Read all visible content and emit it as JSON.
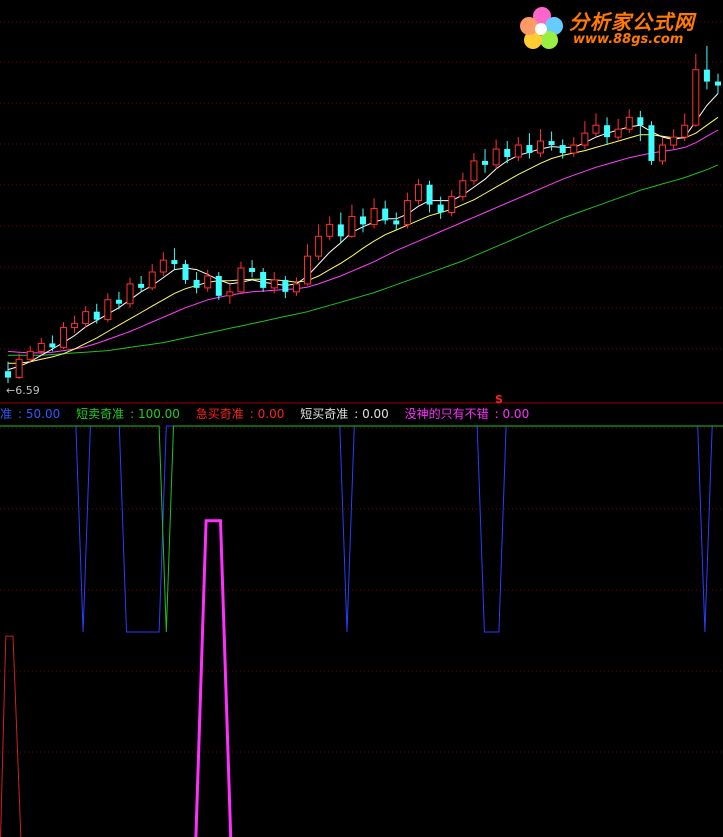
{
  "logo": {
    "name": "分析家公式网",
    "url": "www.88gs.com"
  },
  "price_low_label": "←6.59",
  "signal_marker": "S",
  "legend": [
    {
      "label": "准",
      "value": "50.00",
      "color": "#2a5cff"
    },
    {
      "label": "短卖奇准",
      "value": "100.00",
      "color": "#20d020"
    },
    {
      "label": "急买奇准",
      "value": "0.00",
      "color": "#ff2020"
    },
    {
      "label": "短买奇准",
      "value": "0.00",
      "color": "#e0e0e0"
    },
    {
      "label": "没神的只有不错",
      "value": "0.00",
      "color": "#ff30ff"
    }
  ],
  "colors": {
    "up": "#ff3030",
    "down": "#40ffff",
    "ma_short": "#ffffff",
    "ma_mid": "#ffff60",
    "ma_long": "#ff40ff",
    "ma_slow": "#20c020",
    "grid": "#7a0000"
  },
  "chart_data": [
    {
      "type": "candlestick",
      "title": "",
      "ylim": [
        6.4,
        11.0
      ],
      "candles": [
        [
          6.7,
          6.62,
          6.82,
          6.55
        ],
        [
          6.62,
          6.85,
          6.92,
          6.6
        ],
        [
          6.85,
          6.95,
          7.02,
          6.8
        ],
        [
          6.95,
          7.05,
          7.12,
          6.9
        ],
        [
          7.05,
          7.0,
          7.15,
          6.95
        ],
        [
          7.0,
          7.25,
          7.32,
          6.98
        ],
        [
          7.25,
          7.3,
          7.4,
          7.18
        ],
        [
          7.3,
          7.45,
          7.52,
          7.25
        ],
        [
          7.45,
          7.35,
          7.55,
          7.3
        ],
        [
          7.35,
          7.6,
          7.68,
          7.32
        ],
        [
          7.6,
          7.55,
          7.7,
          7.48
        ],
        [
          7.55,
          7.8,
          7.88,
          7.5
        ],
        [
          7.8,
          7.75,
          7.9,
          7.7
        ],
        [
          7.75,
          7.95,
          8.05,
          7.72
        ],
        [
          7.95,
          8.1,
          8.2,
          7.9
        ],
        [
          8.1,
          8.05,
          8.25,
          7.98
        ],
        [
          8.05,
          7.85,
          8.1,
          7.8
        ],
        [
          7.85,
          7.75,
          7.95,
          7.68
        ],
        [
          7.75,
          7.9,
          7.98,
          7.7
        ],
        [
          7.9,
          7.65,
          7.95,
          7.6
        ],
        [
          7.65,
          7.7,
          7.8,
          7.55
        ],
        [
          7.7,
          8.0,
          8.08,
          7.68
        ],
        [
          8.0,
          7.95,
          8.1,
          7.88
        ],
        [
          7.95,
          7.75,
          8.0,
          7.7
        ],
        [
          7.75,
          7.85,
          7.95,
          7.68
        ],
        [
          7.85,
          7.7,
          7.9,
          7.62
        ],
        [
          7.7,
          7.8,
          7.88,
          7.65
        ],
        [
          7.8,
          8.15,
          8.3,
          7.78
        ],
        [
          8.15,
          8.4,
          8.55,
          8.1
        ],
        [
          8.4,
          8.55,
          8.65,
          8.35
        ],
        [
          8.55,
          8.4,
          8.7,
          8.32
        ],
        [
          8.4,
          8.65,
          8.8,
          8.38
        ],
        [
          8.65,
          8.55,
          8.75,
          8.45
        ],
        [
          8.55,
          8.75,
          8.88,
          8.5
        ],
        [
          8.75,
          8.6,
          8.85,
          8.55
        ],
        [
          8.6,
          8.55,
          8.7,
          8.48
        ],
        [
          8.55,
          8.85,
          8.95,
          8.5
        ],
        [
          8.85,
          9.05,
          9.12,
          8.8
        ],
        [
          9.05,
          8.8,
          9.1,
          8.7
        ],
        [
          8.8,
          8.7,
          8.9,
          8.62
        ],
        [
          8.7,
          8.9,
          8.98,
          8.65
        ],
        [
          8.9,
          9.1,
          9.2,
          8.85
        ],
        [
          9.1,
          9.35,
          9.45,
          9.05
        ],
        [
          9.35,
          9.3,
          9.5,
          9.2
        ],
        [
          9.3,
          9.5,
          9.62,
          9.25
        ],
        [
          9.5,
          9.4,
          9.6,
          9.32
        ],
        [
          9.4,
          9.55,
          9.65,
          9.35
        ],
        [
          9.55,
          9.45,
          9.7,
          9.38
        ],
        [
          9.45,
          9.6,
          9.75,
          9.4
        ],
        [
          9.6,
          9.55,
          9.72,
          9.48
        ],
        [
          9.55,
          9.45,
          9.62,
          9.38
        ],
        [
          9.45,
          9.55,
          9.65,
          9.4
        ],
        [
          9.55,
          9.7,
          9.85,
          9.5
        ],
        [
          9.7,
          9.8,
          9.95,
          9.65
        ],
        [
          9.8,
          9.65,
          9.9,
          9.55
        ],
        [
          9.65,
          9.75,
          9.88,
          9.6
        ],
        [
          9.75,
          9.9,
          10.0,
          9.7
        ],
        [
          9.9,
          9.8,
          9.98,
          9.6
        ],
        [
          9.8,
          9.35,
          9.85,
          9.3
        ],
        [
          9.35,
          9.55,
          9.65,
          9.3
        ],
        [
          9.55,
          9.65,
          9.75,
          9.5
        ],
        [
          9.65,
          9.8,
          9.95,
          9.6
        ],
        [
          9.8,
          10.5,
          10.7,
          9.78
        ],
        [
          10.5,
          10.35,
          10.8,
          10.25
        ],
        [
          10.35,
          10.3,
          10.45,
          10.2
        ]
      ],
      "ma": {
        "ma_short": [
          6.72,
          6.76,
          6.82,
          6.9,
          6.98,
          7.06,
          7.15,
          7.26,
          7.34,
          7.42,
          7.5,
          7.6,
          7.7,
          7.78,
          7.88,
          7.98,
          8.0,
          7.98,
          7.92,
          7.85,
          7.8,
          7.82,
          7.85,
          7.82,
          7.8,
          7.78,
          7.8,
          7.9,
          8.05,
          8.2,
          8.32,
          8.45,
          8.52,
          8.58,
          8.62,
          8.62,
          8.68,
          8.78,
          8.85,
          8.85,
          8.85,
          8.92,
          9.02,
          9.12,
          9.25,
          9.35,
          9.42,
          9.46,
          9.5,
          9.53,
          9.52,
          9.52,
          9.58,
          9.65,
          9.7,
          9.74,
          9.78,
          9.8,
          9.72,
          9.65,
          9.62,
          9.65,
          9.85,
          10.05,
          10.2
        ],
        "ma_mid": [
          6.8,
          6.8,
          6.82,
          6.85,
          6.88,
          6.92,
          6.98,
          7.05,
          7.12,
          7.2,
          7.28,
          7.36,
          7.44,
          7.52,
          7.6,
          7.68,
          7.74,
          7.78,
          7.82,
          7.84,
          7.84,
          7.85,
          7.86,
          7.86,
          7.85,
          7.84,
          7.82,
          7.84,
          7.9,
          7.98,
          8.06,
          8.15,
          8.25,
          8.34,
          8.42,
          8.48,
          8.54,
          8.6,
          8.66,
          8.7,
          8.74,
          8.8,
          8.86,
          8.94,
          9.02,
          9.1,
          9.18,
          9.25,
          9.32,
          9.38,
          9.42,
          9.45,
          9.48,
          9.52,
          9.56,
          9.6,
          9.64,
          9.68,
          9.68,
          9.66,
          9.64,
          9.64,
          9.7,
          9.8,
          9.9
        ],
        "ma_long": [
          6.95,
          6.94,
          6.93,
          6.93,
          6.94,
          6.96,
          6.98,
          7.01,
          7.05,
          7.1,
          7.15,
          7.2,
          7.26,
          7.32,
          7.38,
          7.44,
          7.5,
          7.55,
          7.6,
          7.63,
          7.66,
          7.68,
          7.7,
          7.71,
          7.72,
          7.73,
          7.74,
          7.76,
          7.8,
          7.85,
          7.9,
          7.96,
          8.02,
          8.08,
          8.15,
          8.22,
          8.28,
          8.34,
          8.4,
          8.46,
          8.52,
          8.58,
          8.64,
          8.7,
          8.76,
          8.82,
          8.88,
          8.94,
          9.0,
          9.06,
          9.12,
          9.17,
          9.22,
          9.27,
          9.31,
          9.35,
          9.39,
          9.42,
          9.45,
          9.47,
          9.49,
          9.52,
          9.58,
          9.66,
          9.74
        ],
        "ma_slow": [
          6.9,
          6.9,
          6.9,
          6.9,
          6.91,
          6.92,
          6.93,
          6.94,
          6.95,
          6.96,
          6.98,
          7.0,
          7.02,
          7.04,
          7.06,
          7.09,
          7.12,
          7.15,
          7.18,
          7.21,
          7.24,
          7.27,
          7.3,
          7.33,
          7.36,
          7.39,
          7.42,
          7.45,
          7.49,
          7.53,
          7.57,
          7.61,
          7.65,
          7.69,
          7.74,
          7.79,
          7.84,
          7.89,
          7.94,
          7.99,
          8.04,
          8.09,
          8.15,
          8.21,
          8.27,
          8.33,
          8.39,
          8.45,
          8.51,
          8.57,
          8.63,
          8.68,
          8.73,
          8.78,
          8.83,
          8.88,
          8.93,
          8.98,
          9.02,
          9.06,
          9.1,
          9.14,
          9.19,
          9.24,
          9.3
        ]
      }
    },
    {
      "type": "line",
      "title": "",
      "ylim": [
        0,
        100
      ],
      "x": [
        0,
        4,
        8,
        12,
        16,
        20,
        24,
        28,
        32,
        36,
        40,
        44,
        48,
        52,
        56,
        60,
        64,
        68,
        72,
        76,
        80,
        84,
        88,
        92,
        96,
        100
      ],
      "series": [
        {
          "key": "blue",
          "points": [
            [
              0,
              100
            ],
            [
              10.5,
              100
            ],
            [
              11.5,
              50
            ],
            [
              12.5,
              100
            ],
            [
              16.5,
              100
            ],
            [
              17.5,
              50
            ],
            [
              22,
              50
            ],
            [
              23,
              100
            ],
            [
              47,
              100
            ],
            [
              48,
              50
            ],
            [
              49,
              100
            ],
            [
              66,
              100
            ],
            [
              67,
              50
            ],
            [
              69,
              50
            ],
            [
              70,
              100
            ],
            [
              96.5,
              100
            ],
            [
              97.5,
              50
            ],
            [
              98.5,
              100
            ],
            [
              100,
              100
            ]
          ]
        },
        {
          "key": "green",
          "points": [
            [
              0,
              100
            ],
            [
              22,
              100
            ],
            [
              23,
              50
            ],
            [
              24,
              100
            ],
            [
              100,
              100
            ]
          ]
        },
        {
          "key": "magenta",
          "points": [
            [
              27,
              -5
            ],
            [
              28.5,
              77
            ],
            [
              30.5,
              77
            ],
            [
              32,
              -5
            ]
          ]
        },
        {
          "key": "red",
          "points": [
            [
              0,
              -5
            ],
            [
              0.8,
              49
            ],
            [
              1.8,
              49
            ],
            [
              3,
              -5
            ]
          ]
        }
      ]
    }
  ]
}
